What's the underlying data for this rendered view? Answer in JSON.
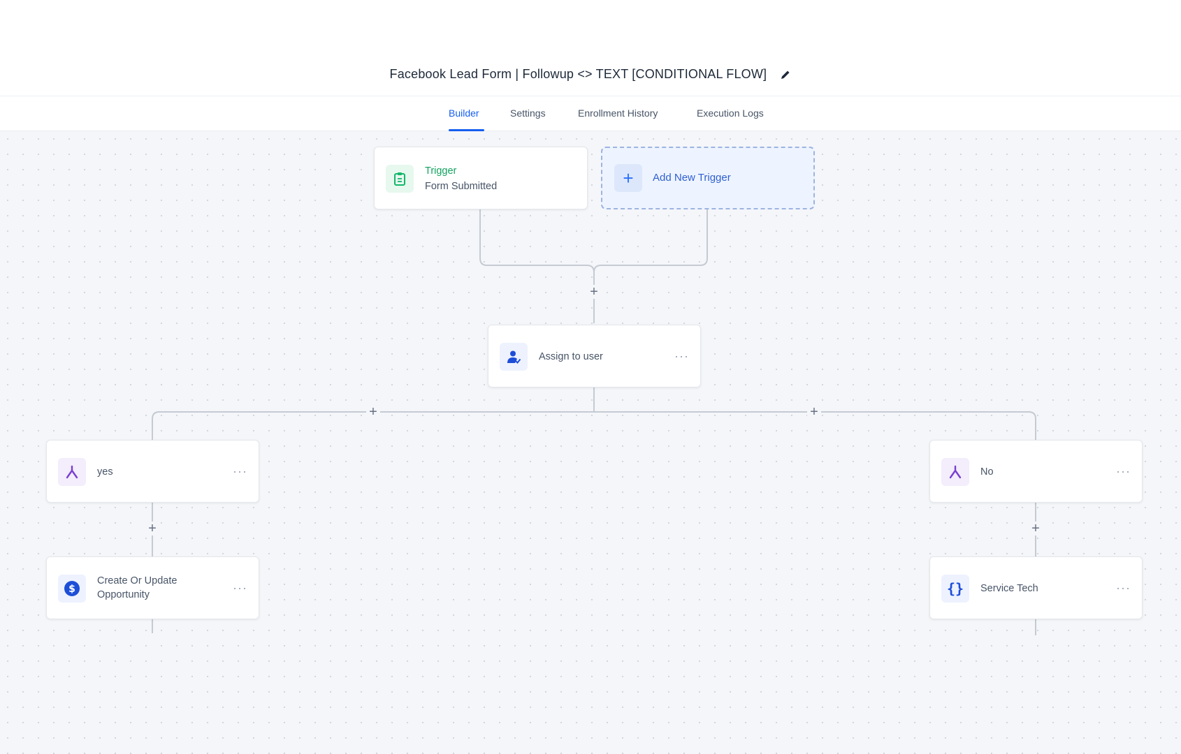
{
  "workflow": {
    "title": "Facebook Lead Form | Followup <> TEXT [CONDITIONAL FLOW]"
  },
  "tabs": [
    {
      "label": "Builder",
      "active": true
    },
    {
      "label": "Settings",
      "active": false
    },
    {
      "label": "Enrollment History",
      "active": false
    },
    {
      "label": "Execution Logs",
      "active": false
    }
  ],
  "trigger": {
    "title": "Trigger",
    "subtitle": "Form Submitted",
    "icon": "clipboard-icon"
  },
  "add_trigger": {
    "label": "Add New Trigger",
    "icon": "plus-icon"
  },
  "actions": {
    "assign": {
      "label": "Assign to user",
      "icon": "user-assign-icon"
    },
    "branch_yes": {
      "label": "yes",
      "icon": "branch-icon"
    },
    "branch_no": {
      "label": "No",
      "icon": "branch-icon"
    },
    "opportunity": {
      "label": "Create Or Update Opportunity",
      "icon": "dollar-icon"
    },
    "service_tech": {
      "label": "Service Tech",
      "icon": "braces-icon"
    }
  },
  "more_glyph": "···",
  "colors": {
    "accent": "#155eef",
    "trigger_green": "#12b76a",
    "branch_purple": "#7a3fd1",
    "user_blue": "#1d4ed8",
    "canvas_bg": "#f5f6f9"
  }
}
